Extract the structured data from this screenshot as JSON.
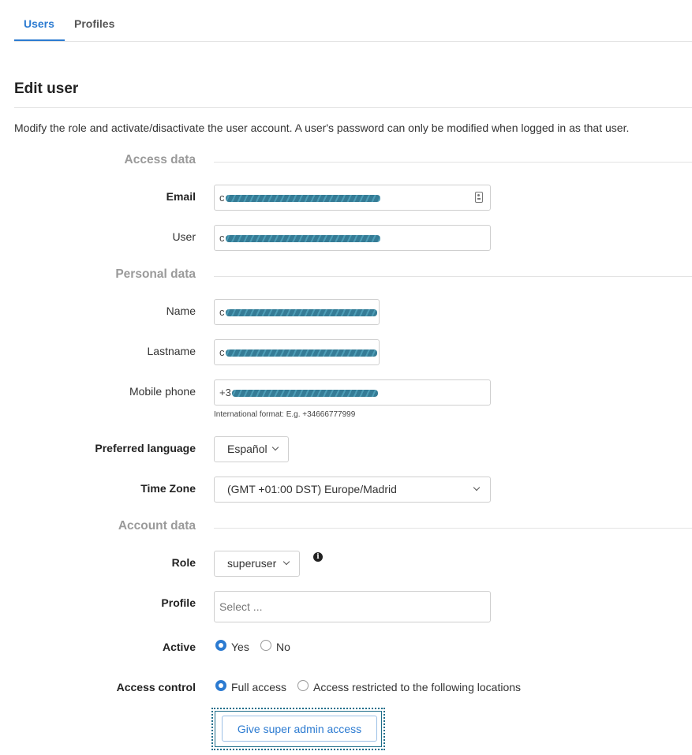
{
  "tabs": [
    {
      "label": "Users",
      "active": true
    },
    {
      "label": "Profiles",
      "active": false
    }
  ],
  "page_title": "Edit user",
  "description": "Modify the role and activate/disactivate the user account. A user's password can only be modified when logged in as that user.",
  "sections": {
    "access": "Access data",
    "personal": "Personal data",
    "account": "Account data"
  },
  "fields": {
    "email": {
      "label": "Email",
      "value_prefix": "c",
      "masked": true,
      "icon": "contact-card-icon"
    },
    "user": {
      "label": "User",
      "value_prefix": "c",
      "masked": true
    },
    "name": {
      "label": "Name",
      "value_prefix": "c",
      "masked": true
    },
    "lastname": {
      "label": "Lastname",
      "value_prefix": "c",
      "masked": true
    },
    "mobile": {
      "label": "Mobile phone",
      "value_prefix": "+3",
      "masked": true,
      "hint": "International format: E.g. +34666777999"
    },
    "language": {
      "label": "Preferred language",
      "value": "Español"
    },
    "timezone": {
      "label": "Time Zone",
      "value": "(GMT +01:00 DST) Europe/Madrid"
    },
    "role": {
      "label": "Role",
      "value": "superuser"
    },
    "profile": {
      "label": "Profile",
      "placeholder": "Select ..."
    },
    "active": {
      "label": "Active",
      "options": [
        "Yes",
        "No"
      ],
      "selected": "Yes"
    },
    "access_control": {
      "label": "Access control",
      "options": [
        "Full access",
        "Access restricted to the following locations"
      ],
      "selected": "Full access"
    }
  },
  "buttons": {
    "super_admin": "Give super admin access"
  },
  "colors": {
    "accent": "#2c7bd1",
    "section_text": "#9a9a9a",
    "redaction": "#1f6e8a"
  }
}
